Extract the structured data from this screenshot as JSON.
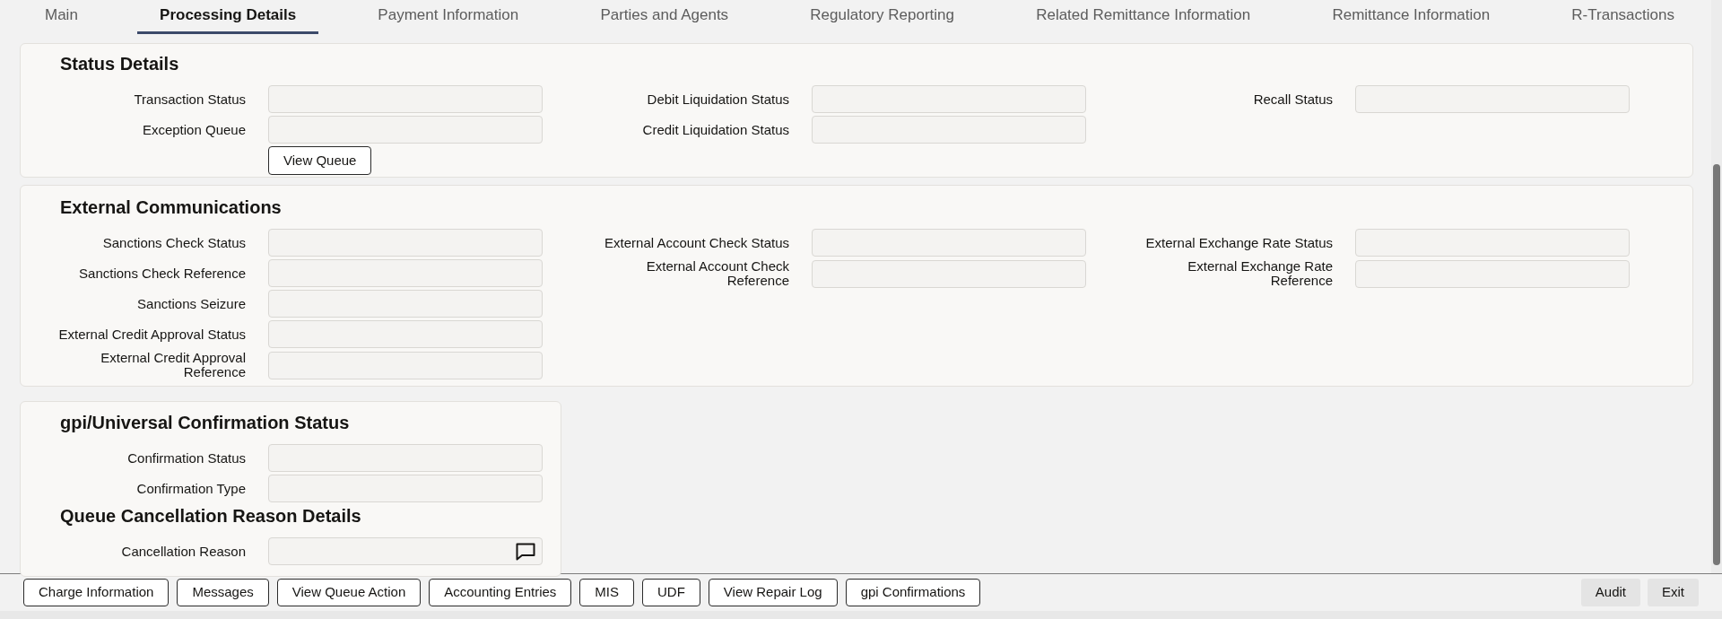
{
  "tabs": [
    {
      "label": "Main",
      "selected": false
    },
    {
      "label": "Processing Details",
      "selected": true
    },
    {
      "label": "Payment Information",
      "selected": false
    },
    {
      "label": "Parties and Agents",
      "selected": false
    },
    {
      "label": "Regulatory Reporting",
      "selected": false
    },
    {
      "label": "Related Remittance Information",
      "selected": false
    },
    {
      "label": "Remittance Information",
      "selected": false
    },
    {
      "label": "R-Transactions",
      "selected": false
    }
  ],
  "sections": [
    {
      "title": "Status Details",
      "columns": [
        [
          {
            "kind": "field",
            "label": "Transaction Status"
          },
          {
            "kind": "field",
            "label": "Exception Queue"
          },
          {
            "kind": "button",
            "label": "View Queue"
          }
        ],
        [
          {
            "kind": "field",
            "label": "Debit Liquidation Status"
          },
          {
            "kind": "field",
            "label": "Credit Liquidation Status"
          }
        ],
        [
          {
            "kind": "field",
            "label": "Recall Status"
          }
        ]
      ]
    },
    {
      "title": "External Communications",
      "columns": [
        [
          {
            "kind": "field",
            "label": "Sanctions Check Status"
          },
          {
            "kind": "field",
            "label": "Sanctions Check Reference"
          },
          {
            "kind": "field",
            "label": "Sanctions Seizure"
          },
          {
            "kind": "field",
            "label": "External Credit Approval Status"
          },
          {
            "kind": "field",
            "label": "External Credit Approval Reference"
          }
        ],
        [
          {
            "kind": "field",
            "label": "External Account Check Status"
          },
          {
            "kind": "field",
            "label": "External Account Check Reference"
          }
        ],
        [
          {
            "kind": "field",
            "label": "External Exchange Rate Status"
          },
          {
            "kind": "field",
            "label": "External Exchange Rate Reference"
          }
        ]
      ]
    }
  ],
  "confirmation_panel": {
    "groups": [
      {
        "title": "gpi/Universal Confirmation Status",
        "items": [
          {
            "kind": "field",
            "label": "Confirmation Status"
          },
          {
            "kind": "field",
            "label": "Confirmation Type"
          }
        ]
      },
      {
        "title": "Queue Cancellation Reason Details",
        "items": [
          {
            "kind": "remark_field",
            "label": "Cancellation Reason"
          }
        ]
      }
    ]
  },
  "footer": {
    "actions": [
      "Charge Information",
      "Messages",
      "View Queue Action",
      "Accounting Entries",
      "MIS",
      "UDF",
      "View Repair Log",
      "gpi Confirmations"
    ],
    "window_buttons": [
      "Audit",
      "Exit"
    ]
  }
}
